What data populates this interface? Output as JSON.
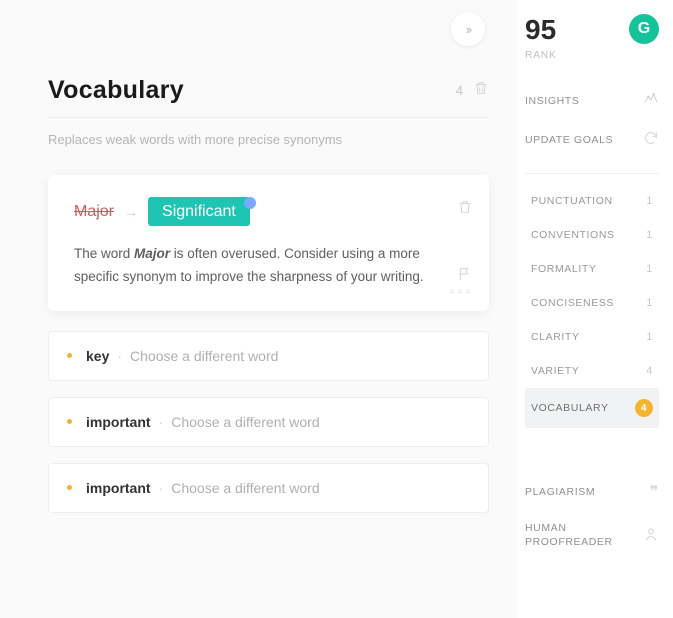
{
  "header": {
    "title": "Vocabulary",
    "count": "4",
    "description": "Replaces weak words with more precise synonyms"
  },
  "card": {
    "original": "Major",
    "replacement": "Significant",
    "body_pre": "The word ",
    "body_em": "Major",
    "body_post": " is often overused. Consider using a more specific synonym to improve the sharpness of your writing."
  },
  "suggestions": [
    {
      "word": "key",
      "hint": "Choose a different word"
    },
    {
      "word": "important",
      "hint": "Choose a different word"
    },
    {
      "word": "important",
      "hint": "Choose a different word"
    }
  ],
  "sidebar": {
    "score": "95",
    "rank_label": "RANK",
    "logo_letter": "G",
    "links": {
      "insights": "INSIGHTS",
      "update_goals": "UPDATE GOALS"
    },
    "categories": [
      {
        "label": "PUNCTUATION",
        "count": "1",
        "active": false
      },
      {
        "label": "CONVENTIONS",
        "count": "1",
        "active": false
      },
      {
        "label": "FORMALITY",
        "count": "1",
        "active": false
      },
      {
        "label": "CONCISENESS",
        "count": "1",
        "active": false
      },
      {
        "label": "CLARITY",
        "count": "1",
        "active": false
      },
      {
        "label": "VARIETY",
        "count": "4",
        "active": false
      },
      {
        "label": "VOCABULARY",
        "count": "4",
        "active": true
      }
    ],
    "features": {
      "plagiarism": "PLAGIARISM",
      "proofreader": "HUMAN PROOFREADER"
    }
  },
  "separator": "·"
}
